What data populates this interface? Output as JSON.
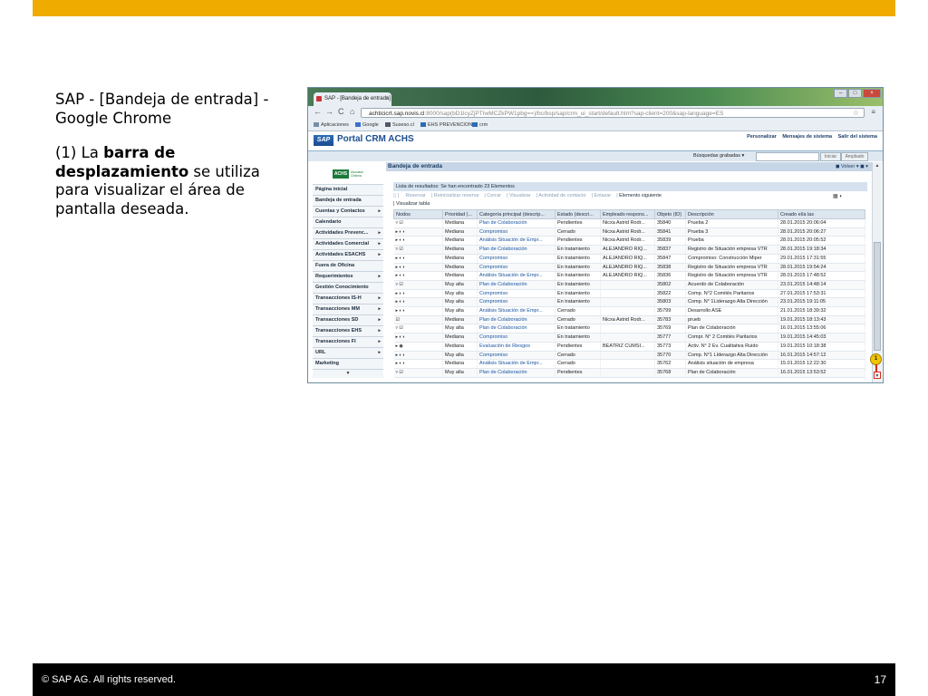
{
  "slide": {
    "caption_title": "SAP - [Bandeja de entrada] - Google Chrome",
    "desc_prefix": "(1) La ",
    "desc_bold": "barra de desplazamiento",
    "desc_suffix": " se utiliza para visualizar el área de pantalla deseada.",
    "footer_copyright": "©  SAP AG. All rights reserved.",
    "page_number": "17",
    "accent_color": "#f0ab00"
  },
  "browser": {
    "tab_title": "SAP - [Bandeja de entrada]",
    "url_host": "achticicrt.sap.novis.cl",
    "url_rest": ":8000/sap(bD1lcyZjPTIwMCZkPW1pbg==)/bc/bsp/sap/crm_ui_start/default.htm?sap-client=200&sap-language=ES",
    "bookmarks": [
      "Aplicaciones",
      "Google",
      "Suseso.cl",
      "EHS PREVENCION",
      "crm"
    ]
  },
  "sap": {
    "logo": "SAP",
    "portal_title": "Portal CRM ACHS",
    "top_links": [
      "Personalizar",
      "Mensajes de sistema",
      "Salir del sistema"
    ],
    "search_label": "Búsquedas grabadas",
    "iniciar_label": "Iniciar",
    "ampliado_label": "Ampliado",
    "brand_logo": "ACHS",
    "brand_sub": "Asociación Chilena de Seguridad"
  },
  "nav": {
    "items": [
      {
        "label": "Página inicial",
        "arrow": ""
      },
      {
        "label": "Bandeja de entrada",
        "arrow": ""
      },
      {
        "label": "Cuentas y Contactos",
        "arrow": "▸"
      },
      {
        "label": "Calendario",
        "arrow": ""
      },
      {
        "label": "Actividades Prevenc...",
        "arrow": "▸"
      },
      {
        "label": "Actividades Comercial",
        "arrow": "▸"
      },
      {
        "label": "Actividades ESACHS",
        "arrow": "▸"
      },
      {
        "label": "Fuera de Oficina",
        "arrow": ""
      },
      {
        "label": "Requerimientos",
        "arrow": "▸"
      },
      {
        "label": "Gestión Conocimiento",
        "arrow": ""
      },
      {
        "label": "Transacciones IS-H",
        "arrow": "▸"
      },
      {
        "label": "Transacciones MM",
        "arrow": "▸"
      },
      {
        "label": "Transacciones SD",
        "arrow": "▸"
      },
      {
        "label": "Transacciones EHS",
        "arrow": "▸"
      },
      {
        "label": "Transacciones FI",
        "arrow": "▸"
      },
      {
        "label": "URL",
        "arrow": "▸"
      },
      {
        "label": "Marketing",
        "arrow": ""
      }
    ],
    "more": "▼"
  },
  "inbox": {
    "title": "Bandeja de entrada",
    "back_label": "Volver",
    "results": "Lista de resultados: Se han encontrado 23 Elementos",
    "toolbar": [
      "Reservar",
      "Reinicializar reserva",
      "Cerrar",
      "Visualizar",
      "Actividad de contacto",
      "Enlazar"
    ],
    "toolbar_active": "Elemento siguiente",
    "view_table": "Visualizar tabla",
    "columns": [
      "Nodos",
      "Prioridad (...",
      "Categoría principal (descrip...",
      "Estado (descri...",
      "Empleado respons...",
      "Objeto (ID)",
      "Descripción",
      "Creado el/a las"
    ],
    "rows": [
      {
        "node": "▿ ☑",
        "prio": "Mediana",
        "cat": "Plan de Colaboración",
        "estado": "Pendientes",
        "emp": "Nicxa Astrid Rodr...",
        "id": "35840",
        "desc": "Prueba 2",
        "fecha": "28.01.2015 20:06:04"
      },
      {
        "node": "▸ ◐◑",
        "prio": "Mediana",
        "cat": "Compromiso",
        "estado": "Cerrado",
        "emp": "Nicxa Astrid Rodr...",
        "id": "35841",
        "desc": "Prueba 3",
        "fecha": "28.01.2015 20:06:27"
      },
      {
        "node": "▸ ◐◑",
        "prio": "Mediana",
        "cat": "Análisis Situación de Empr...",
        "estado": "Pendientes",
        "emp": "Nicxa Astrid Rodr...",
        "id": "35839",
        "desc": "Prueba",
        "fecha": "28.01.2015 20:05:52"
      },
      {
        "node": "▿ ☑",
        "prio": "Mediana",
        "cat": "Plan de Colaboración",
        "estado": "En tratamiento",
        "emp": "ALEJANDRO RIQ...",
        "id": "35837",
        "desc": "Registro de Situación empresa VTR",
        "fecha": "28.01.2015 19:18:34"
      },
      {
        "node": "▸ ◐◑",
        "prio": "Mediana",
        "cat": "Compromiso",
        "estado": "En tratamiento",
        "emp": "ALEJANDRO RIQ...",
        "id": "35847",
        "desc": "Compromiso: Construcción Miper",
        "fecha": "29.01.2015 17:31:55"
      },
      {
        "node": "▸ ◐◑",
        "prio": "Mediana",
        "cat": "Compromiso",
        "estado": "En tratamiento",
        "emp": "ALEJANDRO RIQ...",
        "id": "35838",
        "desc": "Registro de Situación empresa VTR",
        "fecha": "28.01.2015 19:54:24"
      },
      {
        "node": "▸ ◐◑",
        "prio": "Mediana",
        "cat": "Análisis Situación de Empr...",
        "estado": "En tratamiento",
        "emp": "ALEJANDRO RIQ...",
        "id": "35836",
        "desc": "Registro de Situación empresa VTR",
        "fecha": "28.01.2015 17:48:52"
      },
      {
        "node": "▿ ☑",
        "prio": "Muy alta",
        "cat": "Plan de Colaboración",
        "estado": "En tratamiento",
        "emp": "",
        "id": "35802",
        "desc": "Acuerdo de Colaboración",
        "fecha": "23.01.2015 14:48:14"
      },
      {
        "node": "▸ ◐◑",
        "prio": "Muy alta",
        "cat": "Compromiso",
        "estado": "En tratamiento",
        "emp": "",
        "id": "35822",
        "desc": "Comp. N°2 Comités Paritarios",
        "fecha": "27.01.2015 17:53:31"
      },
      {
        "node": "▸ ◐◑",
        "prio": "Muy alta",
        "cat": "Compromiso",
        "estado": "En tratamiento",
        "emp": "",
        "id": "35803",
        "desc": "Comp. N° 1Liderazgo Alta Dirección",
        "fecha": "23.01.2015 19:11:05"
      },
      {
        "node": "▸ ◐◑",
        "prio": "Muy alta",
        "cat": "Análisis Situación de Empr...",
        "estado": "Cerrado",
        "emp": "",
        "id": "35799",
        "desc": "Desarrollo ASE",
        "fecha": "21.01.2015 18:39:32"
      },
      {
        "node": "☑",
        "prio": "Mediana",
        "cat": "Plan de Colaboración",
        "estado": "Cerrado",
        "emp": "Nicxa Astrid Rodr...",
        "id": "35783",
        "desc": "prueb",
        "fecha": "19.01.2015 18:13:43"
      },
      {
        "node": "▿ ☑",
        "prio": "Muy alta",
        "cat": "Plan de Colaboración",
        "estado": "En tratamiento",
        "emp": "",
        "id": "35769",
        "desc": "Plan de Colaboración",
        "fecha": "16.01.2015 13:55:06"
      },
      {
        "node": "▸ ◐◑",
        "prio": "Mediana",
        "cat": "Compromiso",
        "estado": "En tratamiento",
        "emp": "",
        "id": "35777",
        "desc": "Compr. N° 2 Comités Paritarios",
        "fecha": "19.01.2015 14:45:03"
      },
      {
        "node": "▸ ◉",
        "prio": "Mediana",
        "cat": "Evaluación de Riesgos",
        "estado": "Pendientes",
        "emp": "BEATRIZ CUMSI...",
        "id": "35773",
        "desc": "Activ. N° 2 Ev. Cualitativa Ruido",
        "fecha": "19.01.2015 10:18:38"
      },
      {
        "node": "▸ ◐◑",
        "prio": "Muy alta",
        "cat": "Compromiso",
        "estado": "Cerrado",
        "emp": "",
        "id": "35770",
        "desc": "Comp. N°1 LIderazgo Alta Dirección",
        "fecha": "16.01.2015 14:57:12"
      },
      {
        "node": "▸ ◐◑",
        "prio": "Mediana",
        "cat": "Análisis Situación de Empr...",
        "estado": "Cerrado",
        "emp": "",
        "id": "35762",
        "desc": "Análisis situación de empresa",
        "fecha": "15.01.2015 12:22:30"
      },
      {
        "node": "▿ ☑",
        "prio": "Muy alta",
        "cat": "Plan de Colaboración",
        "estado": "Pendientes",
        "emp": "",
        "id": "35768",
        "desc": "Plan de Colaboración",
        "fecha": "16.01.2015 13:53:52"
      }
    ]
  },
  "scrollbar": {
    "callout_number": "1",
    "up_arrow": "▲",
    "down_arrow": "▼"
  }
}
